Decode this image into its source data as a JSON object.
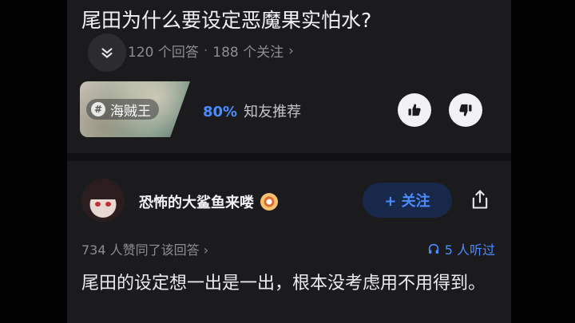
{
  "question": {
    "title": "尾田为什么要设定恶魔果实怕水?",
    "answers_count": "120 个回答",
    "separator": "·",
    "followers_count": "188 个关注",
    "chevron": "›"
  },
  "topic": {
    "hash_symbol": "#",
    "name": "海贼王"
  },
  "recommendation": {
    "percent": "80%",
    "label": "知友推荐"
  },
  "author": {
    "name": "恐怖的大鲨鱼来喽",
    "follow_label": "+ 关注"
  },
  "answer_meta": {
    "votes_text": "734 人赞同了该回答 ›",
    "listeners_text": "5 人听过"
  },
  "answer_text": "尾田的设定想一出是一出，根本没考虑用不用得到。",
  "icons": {
    "collapse": "chevron-down-icon",
    "upvote": "thumbs-up-icon",
    "downvote": "thumbs-down-icon",
    "share": "share-icon",
    "badge": "badge-icon",
    "headphones": "headphones-icon"
  },
  "colors": {
    "accent": "#4d8cff",
    "background": "#1b1b1e",
    "follow_bg": "#17284a"
  }
}
